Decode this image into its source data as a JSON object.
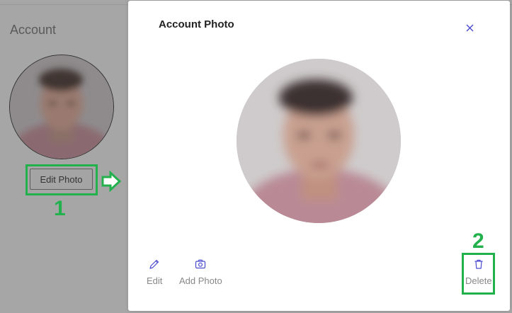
{
  "background": {
    "title": "Account",
    "edit_photo_label": "Edit Photo"
  },
  "annotations": {
    "step1": "1",
    "step2": "2",
    "color": "#22b14c"
  },
  "modal": {
    "title": "Account Photo",
    "close_icon": "close-icon",
    "actions": {
      "edit": "Edit",
      "add_photo": "Add Photo",
      "delete": "Delete"
    },
    "accent_color": "#4a4ad0"
  }
}
